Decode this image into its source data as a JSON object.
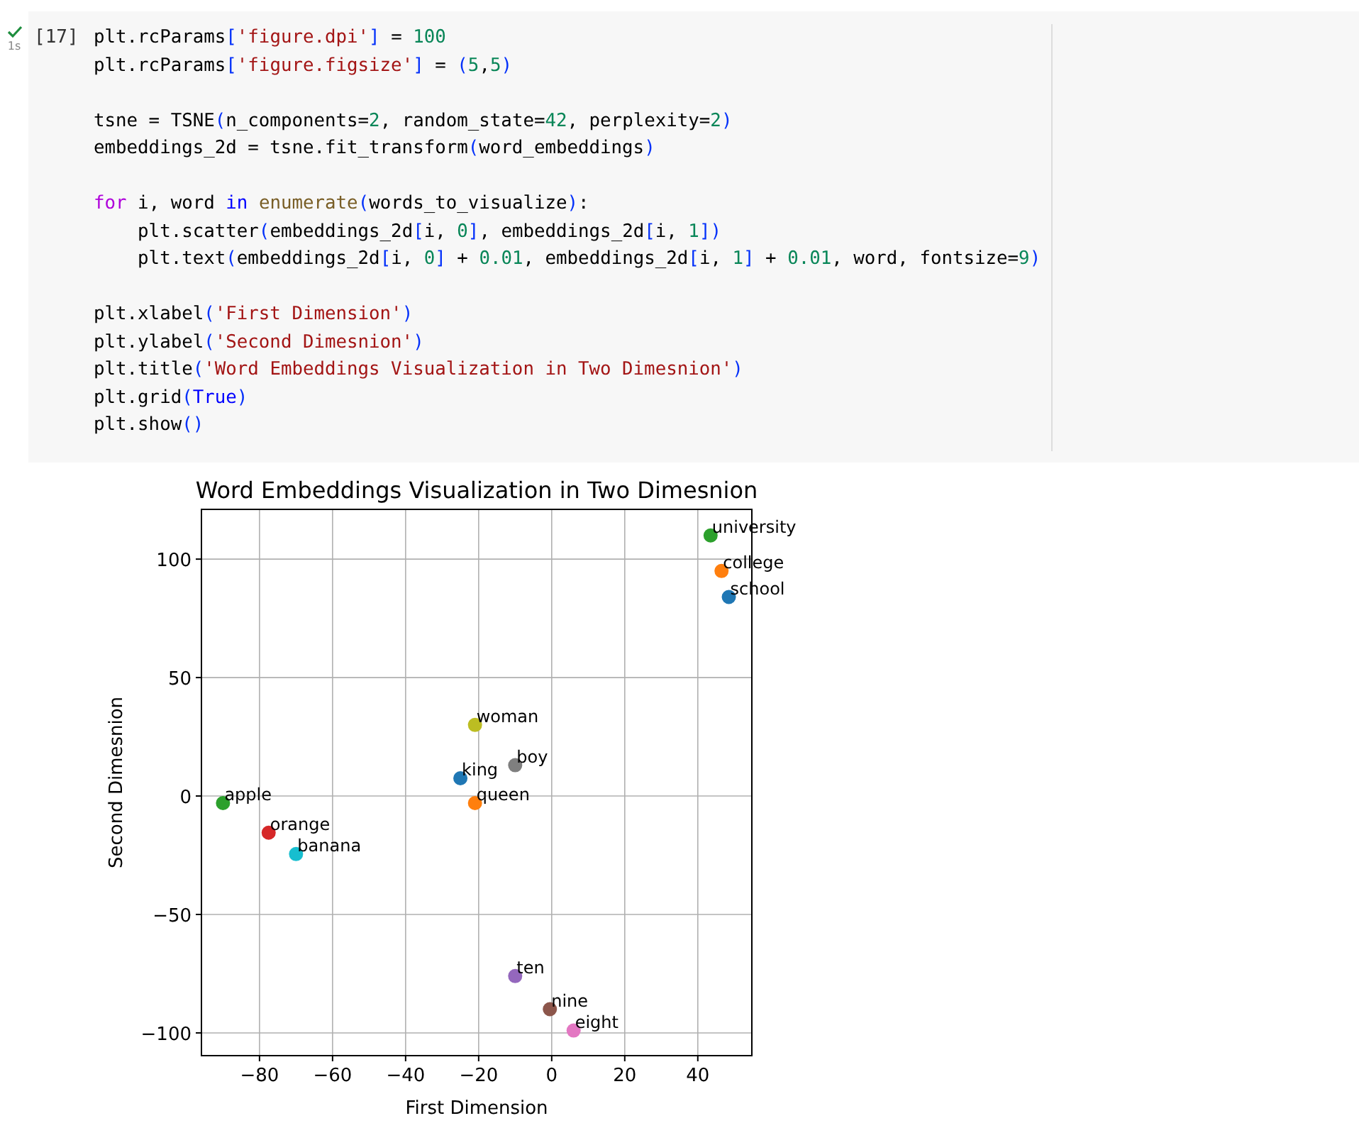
{
  "cell": {
    "status": {
      "done": true,
      "duration": "1s"
    },
    "prompt": "[17]",
    "code_blocks": [
      [
        [
          {
            "kind": "plain",
            "text": "plt.rcParams"
          },
          {
            "kind": "bracket",
            "text": "["
          },
          {
            "kind": "string",
            "text": "'figure.dpi'"
          },
          {
            "kind": "bracket",
            "text": "]"
          },
          {
            "kind": "plain",
            "text": " = "
          },
          {
            "kind": "number",
            "text": "100"
          }
        ],
        [
          {
            "kind": "plain",
            "text": "plt.rcParams"
          },
          {
            "kind": "bracket",
            "text": "["
          },
          {
            "kind": "string",
            "text": "'figure.figsize'"
          },
          {
            "kind": "bracket",
            "text": "]"
          },
          {
            "kind": "plain",
            "text": " = "
          },
          {
            "kind": "bracket",
            "text": "("
          },
          {
            "kind": "number",
            "text": "5"
          },
          {
            "kind": "plain",
            "text": ","
          },
          {
            "kind": "number",
            "text": "5"
          },
          {
            "kind": "bracket",
            "text": ")"
          }
        ]
      ],
      [
        [
          {
            "kind": "plain",
            "text": "tsne = TSNE"
          },
          {
            "kind": "bracket",
            "text": "("
          },
          {
            "kind": "plain",
            "text": "n_components="
          },
          {
            "kind": "number",
            "text": "2"
          },
          {
            "kind": "plain",
            "text": ", random_state="
          },
          {
            "kind": "number",
            "text": "42"
          },
          {
            "kind": "plain",
            "text": ", perplexity="
          },
          {
            "kind": "number",
            "text": "2"
          },
          {
            "kind": "bracket",
            "text": ")"
          }
        ],
        [
          {
            "kind": "plain",
            "text": "embeddings_2d = tsne.fit_transform"
          },
          {
            "kind": "bracket",
            "text": "("
          },
          {
            "kind": "plain",
            "text": "word_embeddings"
          },
          {
            "kind": "bracket",
            "text": ")"
          }
        ]
      ],
      [
        [
          {
            "kind": "keyword",
            "text": "for"
          },
          {
            "kind": "plain",
            "text": " i, word "
          },
          {
            "kind": "operator",
            "text": "in "
          },
          {
            "kind": "function",
            "text": "enumerate"
          },
          {
            "kind": "bracket",
            "text": "("
          },
          {
            "kind": "plain",
            "text": "words_to_visualize"
          },
          {
            "kind": "bracket",
            "text": ")"
          },
          {
            "kind": "plain",
            "text": ":"
          }
        ],
        [
          {
            "kind": "plain",
            "text": "    plt.scatter"
          },
          {
            "kind": "bracket",
            "text": "("
          },
          {
            "kind": "plain",
            "text": "embeddings_2d"
          },
          {
            "kind": "bracket",
            "text": "["
          },
          {
            "kind": "plain",
            "text": "i, "
          },
          {
            "kind": "number",
            "text": "0"
          },
          {
            "kind": "bracket",
            "text": "]"
          },
          {
            "kind": "plain",
            "text": ", embeddings_2d"
          },
          {
            "kind": "bracket",
            "text": "["
          },
          {
            "kind": "plain",
            "text": "i, "
          },
          {
            "kind": "number",
            "text": "1"
          },
          {
            "kind": "bracket",
            "text": "]"
          },
          {
            "kind": "bracket",
            "text": ")"
          }
        ],
        [
          {
            "kind": "plain",
            "text": "    plt.text"
          },
          {
            "kind": "bracket",
            "text": "("
          },
          {
            "kind": "plain",
            "text": "embeddings_2d"
          },
          {
            "kind": "bracket",
            "text": "["
          },
          {
            "kind": "plain",
            "text": "i, "
          },
          {
            "kind": "number",
            "text": "0"
          },
          {
            "kind": "bracket",
            "text": "]"
          },
          {
            "kind": "plain",
            "text": " + "
          },
          {
            "kind": "number",
            "text": "0.01"
          },
          {
            "kind": "plain",
            "text": ", embeddings_2d"
          },
          {
            "kind": "bracket",
            "text": "["
          },
          {
            "kind": "plain",
            "text": "i, "
          },
          {
            "kind": "number",
            "text": "1"
          },
          {
            "kind": "bracket",
            "text": "]"
          },
          {
            "kind": "plain",
            "text": " + "
          },
          {
            "kind": "number",
            "text": "0.01"
          },
          {
            "kind": "plain",
            "text": ", word, fontsize="
          },
          {
            "kind": "number",
            "text": "9"
          },
          {
            "kind": "bracket",
            "text": ")"
          }
        ]
      ],
      [
        [
          {
            "kind": "plain",
            "text": "plt.xlabel"
          },
          {
            "kind": "bracket",
            "text": "("
          },
          {
            "kind": "string",
            "text": "'First Dimension'"
          },
          {
            "kind": "bracket",
            "text": ")"
          }
        ],
        [
          {
            "kind": "plain",
            "text": "plt.ylabel"
          },
          {
            "kind": "bracket",
            "text": "("
          },
          {
            "kind": "string",
            "text": "'Second Dimesnion'"
          },
          {
            "kind": "bracket",
            "text": ")"
          }
        ],
        [
          {
            "kind": "plain",
            "text": "plt.title"
          },
          {
            "kind": "bracket",
            "text": "("
          },
          {
            "kind": "string",
            "text": "'Word Embeddings Visualization in Two Dimesnion'"
          },
          {
            "kind": "bracket",
            "text": ")"
          }
        ],
        [
          {
            "kind": "plain",
            "text": "plt.grid"
          },
          {
            "kind": "bracket",
            "text": "("
          },
          {
            "kind": "constant",
            "text": "True"
          },
          {
            "kind": "bracket",
            "text": ")"
          }
        ],
        [
          {
            "kind": "plain",
            "text": "plt.show"
          },
          {
            "kind": "bracket",
            "text": "("
          },
          {
            "kind": "bracket",
            "text": ")"
          }
        ]
      ]
    ]
  },
  "output": {
    "chart_data": {
      "type": "scatter",
      "title": "Word Embeddings Visualization in Two Dimesnion",
      "xlabel": "First Dimension",
      "ylabel": "Second Dimesnion",
      "grid": true,
      "xlim": [
        -95.9,
        54.8
      ],
      "ylim": [
        -109.6,
        121
      ],
      "xticks": [
        {
          "value": -80,
          "label": "−80"
        },
        {
          "value": -60,
          "label": "−60"
        },
        {
          "value": -40,
          "label": "−40"
        },
        {
          "value": -20,
          "label": "−20"
        },
        {
          "value": 0,
          "label": "0"
        },
        {
          "value": 20,
          "label": "20"
        },
        {
          "value": 40,
          "label": "40"
        }
      ],
      "yticks": [
        {
          "value": -100,
          "label": "−100"
        },
        {
          "value": -50,
          "label": "−50"
        },
        {
          "value": 0,
          "label": "0"
        },
        {
          "value": 50,
          "label": "50"
        },
        {
          "value": 100,
          "label": "100"
        }
      ],
      "series": [
        {
          "name": "king",
          "color": "#1f77b4",
          "x": [
            -25
          ],
          "values": [
            7.5
          ]
        },
        {
          "name": "queen",
          "color": "#ff7f0e",
          "x": [
            -21
          ],
          "values": [
            -3
          ]
        },
        {
          "name": "apple",
          "color": "#2ca02c",
          "x": [
            -90
          ],
          "values": [
            -3
          ]
        },
        {
          "name": "orange",
          "color": "#d62728",
          "x": [
            -77.5
          ],
          "values": [
            -15.5
          ]
        },
        {
          "name": "ten",
          "color": "#9467bd",
          "x": [
            -10
          ],
          "values": [
            -76
          ]
        },
        {
          "name": "nine",
          "color": "#8c564b",
          "x": [
            -0.5
          ],
          "values": [
            -90
          ]
        },
        {
          "name": "eight",
          "color": "#e377c2",
          "x": [
            6
          ],
          "values": [
            -99
          ]
        },
        {
          "name": "boy",
          "color": "#7f7f7f",
          "x": [
            -10
          ],
          "values": [
            13
          ]
        },
        {
          "name": "woman",
          "color": "#bcbd22",
          "x": [
            -21
          ],
          "values": [
            30
          ]
        },
        {
          "name": "banana",
          "color": "#17becf",
          "x": [
            -70
          ],
          "values": [
            -24.5
          ]
        },
        {
          "name": "school",
          "color": "#1f77b4",
          "x": [
            48.5
          ],
          "values": [
            84
          ]
        },
        {
          "name": "college",
          "color": "#ff7f0e",
          "x": [
            46.5
          ],
          "values": [
            95
          ]
        },
        {
          "name": "university",
          "color": "#2ca02c",
          "x": [
            43.5
          ],
          "values": [
            110
          ]
        }
      ]
    }
  }
}
